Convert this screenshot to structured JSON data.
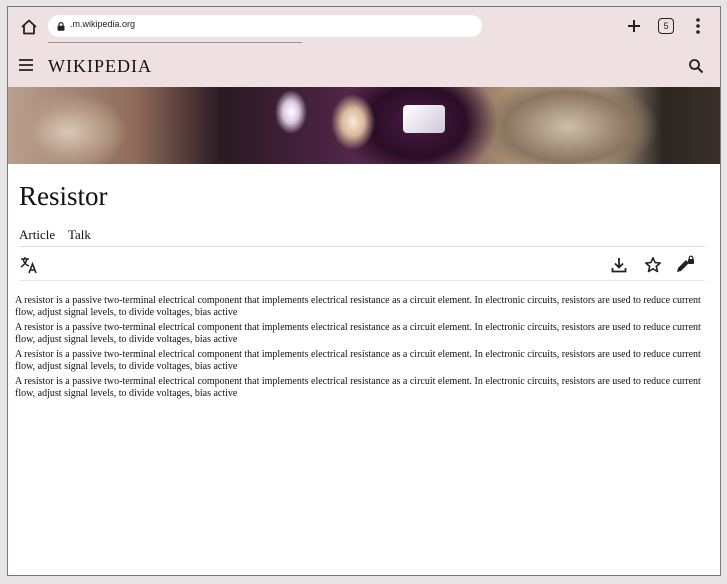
{
  "browser": {
    "url": ".m.wikipedia.org",
    "tab_count": "5"
  },
  "header": {
    "wordmark": "WIKIPEDIA"
  },
  "article": {
    "title": "Resistor",
    "tabs": [
      {
        "label": "Article"
      },
      {
        "label": "Talk"
      }
    ],
    "paragraphs": [
      "A resistor is a passive two-terminal electrical component that implements electrical resistance as a circuit element. In electronic circuits, resistors are used to reduce current flow, adjust signal levels, to divide voltages, bias active",
      "A resistor is a passive two-terminal electrical component that implements electrical resistance as a circuit element. In electronic circuits, resistors are used to reduce current flow, adjust signal levels, to divide voltages, bias active",
      "A resistor is a passive two-terminal electrical component that implements electrical resistance as a circuit element. In electronic circuits, resistors are used to reduce current flow, adjust signal levels, to divide voltages, bias active",
      "A resistor is a passive two-terminal electrical component that implements electrical resistance as a circuit element. In electronic circuits, resistors are used to reduce current flow, adjust signal levels, to divide voltages, bias active"
    ]
  },
  "icons": {
    "home": "home-icon",
    "lock": "lock-icon",
    "new_tab": "plus-icon",
    "overflow": "more-vert-icon",
    "menu": "hamburger-menu-icon",
    "search": "search-icon",
    "language": "translate-icon",
    "download": "download-icon",
    "watch": "star-icon",
    "edit": "edit-locked-icon"
  },
  "colors": {
    "chrome_bg": "#efe1e1",
    "page_bg": "#ffffff",
    "text": "#111111"
  }
}
